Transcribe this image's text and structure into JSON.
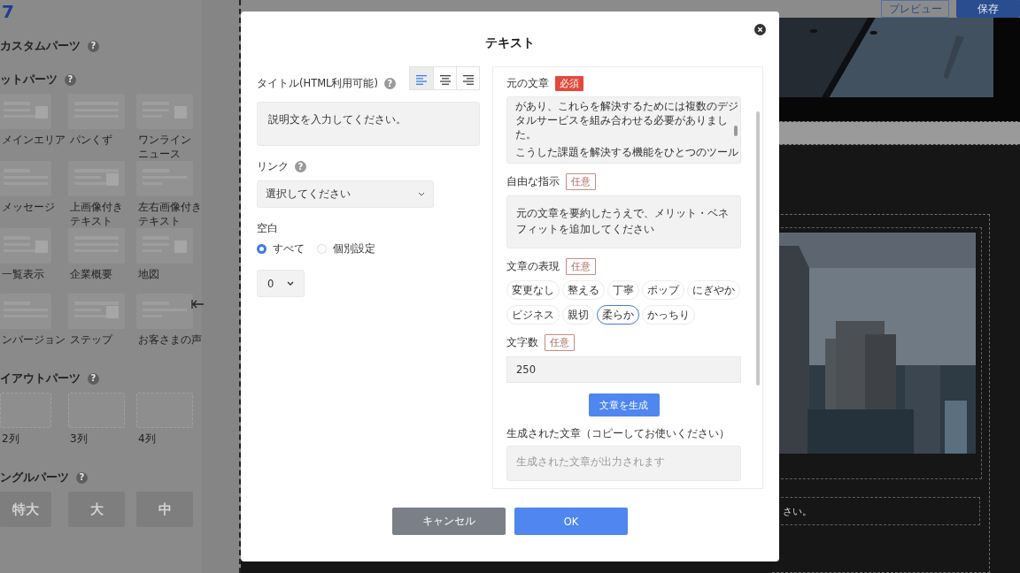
{
  "header": {
    "logo": "7",
    "buttons": [
      {
        "label": "プレビュー",
        "kind": "outline"
      },
      {
        "label": "保存",
        "kind": "primary"
      }
    ]
  },
  "sidebar": {
    "sections": [
      {
        "title": "カスタムパーツ",
        "help": "?"
      },
      {
        "title": "ットパーツ",
        "help": "?",
        "items": [
          {
            "lines": [
              "メインエリア"
            ],
            "kind": "thumb"
          },
          {
            "lines": [
              "パンくず"
            ],
            "kind": "thumb"
          },
          {
            "lines": [
              "ワンライン",
              "ニュース"
            ],
            "kind": "thumb"
          },
          {
            "lines": [
              "メッセージ"
            ],
            "kind": "thumb"
          },
          {
            "lines": [
              "上画像付き",
              "テキスト"
            ],
            "kind": "thumb"
          },
          {
            "lines": [
              "左右画像付き",
              "テキスト"
            ],
            "kind": "thumb"
          },
          {
            "lines": [
              "一覧表示"
            ],
            "kind": "thumb"
          },
          {
            "lines": [
              "企業概要"
            ],
            "kind": "thumb"
          },
          {
            "lines": [
              "地図"
            ],
            "kind": "thumb"
          },
          {
            "lines": [
              "ンバージョン"
            ],
            "kind": "thumb"
          },
          {
            "lines": [
              "ステップ"
            ],
            "kind": "thumb"
          },
          {
            "lines": [
              "お客さまの声"
            ],
            "kind": "thumb"
          }
        ]
      },
      {
        "title": "イアウトパーツ",
        "help": "?",
        "items": [
          {
            "lines": [
              "2列"
            ],
            "kind": "layout"
          },
          {
            "lines": [
              "3列"
            ],
            "kind": "layout"
          },
          {
            "lines": [
              "4列"
            ],
            "kind": "layout"
          }
        ]
      },
      {
        "title": "ングルパーツ",
        "help": "?",
        "items": [
          {
            "lines": [
              "特大"
            ],
            "kind": "text"
          },
          {
            "lines": [
              "大"
            ],
            "kind": "text"
          },
          {
            "lines": [
              "中"
            ],
            "kind": "text"
          }
        ]
      }
    ]
  },
  "canvas": {
    "caption": "さい。"
  },
  "modal": {
    "title": "テキスト",
    "left": {
      "title_label": "タイトル(HTML利用可能)",
      "title_help": "?",
      "align": [
        {
          "kind": "left",
          "selected": true
        },
        {
          "kind": "center",
          "selected": false
        },
        {
          "kind": "right",
          "selected": false
        }
      ],
      "title_value": "説明文を入力してください。",
      "link_label": "リンク",
      "link_help": "?",
      "link_placeholder": "選択してください",
      "spacing_label": "空白",
      "radios": [
        {
          "label": "すべて",
          "selected": true
        },
        {
          "label": "個別設定",
          "selected": false
        }
      ],
      "spacing_value": "0"
    },
    "right": {
      "source": {
        "label": "元の文章",
        "badge": {
          "text": "必須",
          "kind": "required"
        },
        "lines": [
          "があり、これらを解決するためには複数のデジ",
          "タルサービスを組み合わせる必要がありまし",
          "た。",
          "こうした課題を解決する機能をひとつのツール"
        ]
      },
      "instruction": {
        "label": "自由な指示",
        "badge": {
          "text": "任意",
          "kind": "optional"
        },
        "value": "元の文章を要約したうえで、メリット・ベネフィットを追加してください"
      },
      "tone": {
        "label": "文章の表現",
        "badge": {
          "text": "任意",
          "kind": "optional"
        },
        "chips": [
          {
            "label": "変更なし",
            "selected": false
          },
          {
            "label": "整える",
            "selected": false
          },
          {
            "label": "丁寧",
            "selected": false
          },
          {
            "label": "ポップ",
            "selected": false
          },
          {
            "label": "にぎやか",
            "selected": false
          },
          {
            "label": "ビジネス",
            "selected": false
          },
          {
            "label": "親切",
            "selected": false
          },
          {
            "label": "柔らか",
            "selected": true
          },
          {
            "label": "かっちり",
            "selected": false
          }
        ]
      },
      "length": {
        "label": "文字数",
        "badge": {
          "text": "任意",
          "kind": "optional"
        },
        "value": "250"
      },
      "generate": "文章を生成",
      "output": {
        "label": "生成された文章（コピーしてお使いください）",
        "placeholder": "生成された文章が出力されます"
      }
    },
    "buttons": [
      {
        "label": "キャンセル",
        "kind": "secondary"
      },
      {
        "label": "OK",
        "kind": "primary"
      }
    ]
  }
}
